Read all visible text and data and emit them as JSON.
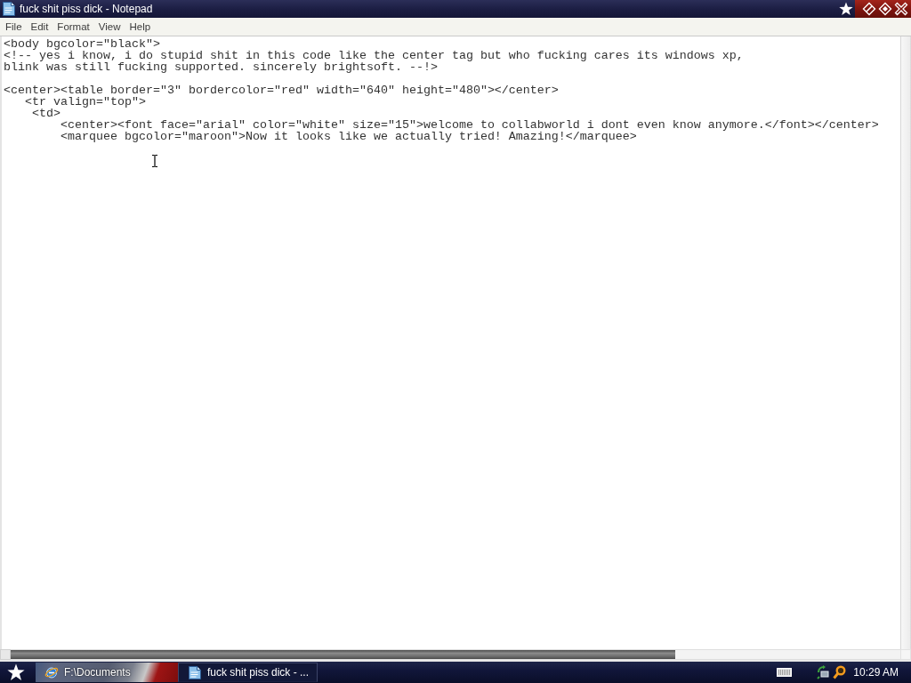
{
  "window": {
    "title": "fuck shit piss dick - Notepad"
  },
  "menu": [
    "File",
    "Edit",
    "Format",
    "View",
    "Help"
  ],
  "document": {
    "blocks": [
      [
        "<body bgcolor=\"black\">",
        "<!-- yes i know, i do stupid shit in this code like the center tag but who fucking cares its windows xp,",
        "blink was still fucking supported. sincerely brightsoft. --!>"
      ],
      [
        "<center><table border=\"3\" bordercolor=\"red\" width=\"640\" height=\"480\"></center>",
        "   <tr valign=\"top\">",
        "    <td>",
        "        <center><font face=\"arial\" color=\"white\" size=\"15\">welcome to collabworld i dont even know anymore.</font></center>",
        "        <marquee bgcolor=\"maroon\">Now it looks like we actually tried! Amazing!</marquee>"
      ]
    ]
  },
  "taskbar": {
    "buttons": [
      {
        "label": "F:\\Documents",
        "kind": "explorer",
        "selected": false
      },
      {
        "label": "fuck shit piss dick - ...",
        "kind": "notepad",
        "selected": true
      }
    ],
    "clock": "10:29 AM"
  }
}
